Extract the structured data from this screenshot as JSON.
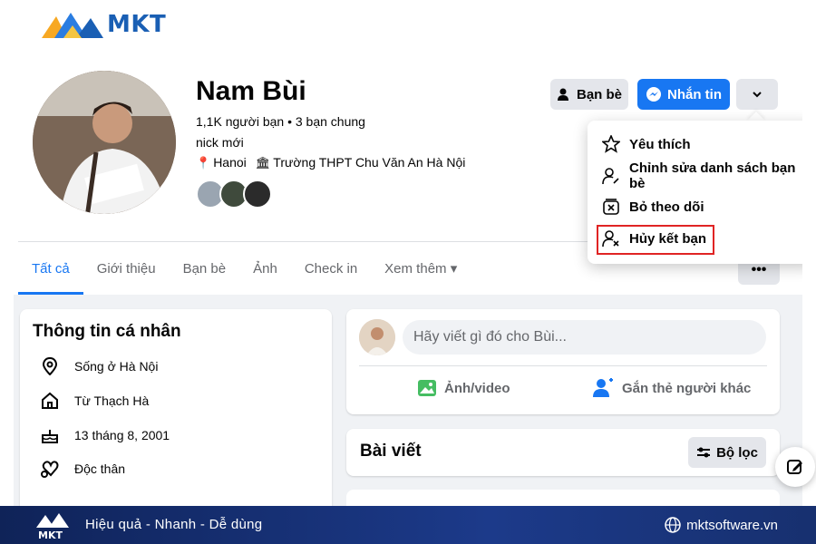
{
  "brand": {
    "logo_text": "MKT"
  },
  "profile": {
    "name": "Nam Bùi",
    "friends_line": "1,1K người bạn • 3 bạn chung",
    "bio": "nick mới",
    "location": "Hanoi",
    "school": "Trường THPT Chu Văn An Hà Nội"
  },
  "actions": {
    "friends_label": "Bạn bè",
    "message_label": "Nhắn tin"
  },
  "dropdown": {
    "items": [
      {
        "label": "Yêu thích",
        "icon": "star-icon"
      },
      {
        "label": "Chỉnh sửa danh sách bạn bè",
        "icon": "edit-friend-list-icon"
      },
      {
        "label": "Bỏ theo dõi",
        "icon": "unfollow-icon"
      },
      {
        "label": "Hủy kết bạn",
        "icon": "unfriend-icon"
      }
    ],
    "highlighted_item": "Hủy kết bạn"
  },
  "tabs": [
    {
      "label": "Tất cả",
      "active": true
    },
    {
      "label": "Giới thiệu"
    },
    {
      "label": "Bạn bè"
    },
    {
      "label": "Ảnh"
    },
    {
      "label": "Check in"
    },
    {
      "label": "Xem thêm"
    }
  ],
  "intro": {
    "title": "Thông tin cá nhân",
    "rows": [
      {
        "icon": "location-pin-icon",
        "text": "Sống ở Hà Nội"
      },
      {
        "icon": "home-icon",
        "text": "Từ Thạch Hà"
      },
      {
        "icon": "birthday-cake-icon",
        "text": "13 tháng 8, 2001"
      },
      {
        "icon": "relationship-heart-icon",
        "text": "Độc thân"
      }
    ]
  },
  "composer": {
    "placeholder": "Hãy viết gì đó cho Bùi...",
    "photo_label": "Ảnh/video",
    "tag_label": "Gắn thẻ người khác"
  },
  "posts": {
    "title": "Bài viết",
    "filter_label": "Bộ lọc"
  },
  "footer": {
    "slogan": "Hiệu quả - Nhanh - Dễ dùng",
    "website": "mktsoftware.vn"
  },
  "colors": {
    "facebook_blue": "#1877f2",
    "highlight_red": "#e02424",
    "footer_navy": "#1c3a8a"
  }
}
